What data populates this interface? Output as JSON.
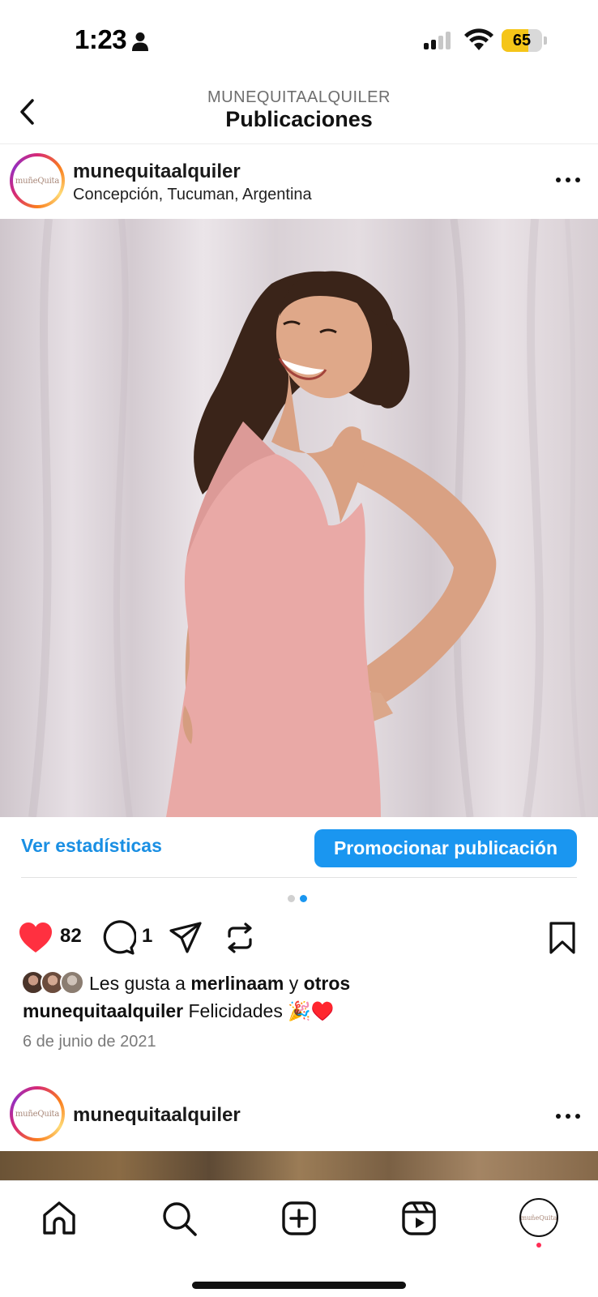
{
  "status_bar": {
    "time": "1:23",
    "battery": "65",
    "battery_level": 0.65,
    "icons": [
      "person-icon",
      "signal-icon",
      "wifi-icon",
      "battery-icon"
    ]
  },
  "header": {
    "subtitle": "MUNEQUITAALQUILER",
    "title": "Publicaciones"
  },
  "post": {
    "username": "munequitaalquiler",
    "location": "Concepción, Tucuman, Argentina",
    "avatar_text": "muñeQuita",
    "insights_label": "Ver estadísticas",
    "promote_label": "Promocionar publicación",
    "carousel": {
      "total": 2,
      "active": 2
    },
    "likes_count": "82",
    "comments_count": "1",
    "likes_prefix": "Les gusta a",
    "likes_user": "merlinaam",
    "likes_connector": "y",
    "likes_others": "otros",
    "caption_user": "munequitaalquiler",
    "caption_text": "Felicidades 🎉♥️",
    "date": "6 de junio de 2021"
  },
  "next_post": {
    "username": "munequitaalquiler",
    "avatar_text": "muñeQuita"
  },
  "nav": {
    "items": [
      "home-icon",
      "search-icon",
      "create-icon",
      "reels-icon",
      "profile-avatar"
    ],
    "avatar_text": "muñeQuita"
  },
  "colors": {
    "accent": "#1a96f0",
    "like": "#ff3040",
    "battery": "#f5c518",
    "dress": "#e9a9a6"
  }
}
